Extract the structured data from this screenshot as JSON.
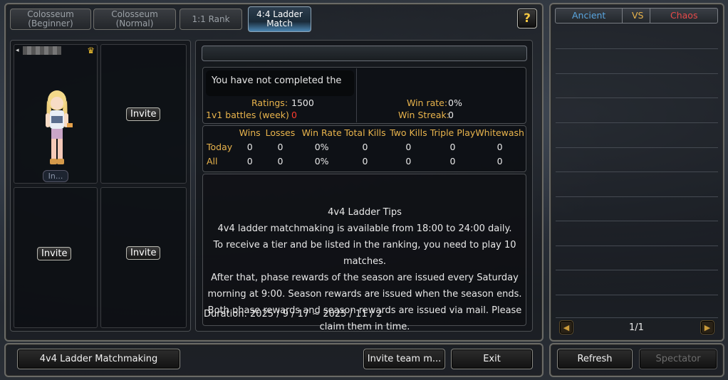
{
  "tabs": [
    {
      "label": "Colosseum (Beginner)"
    },
    {
      "label": "Colosseum (Normal)"
    },
    {
      "label": "1:1 Rank"
    },
    {
      "label": "4:4 Ladder Match"
    }
  ],
  "help_label": "?",
  "party": {
    "leader_name": "",
    "leader_status": "In...",
    "invite_label": "Invite"
  },
  "search_bar_value": "",
  "profile": {
    "notice": "You have not completed the",
    "ratings_label": "Ratings:",
    "ratings_value": "1500",
    "battles_label": "1v1 battles (week)",
    "battles_value": "0",
    "winrate_label": "Win rate:",
    "winrate_value": "0%",
    "winstreak_label": "Win Streak:",
    "winstreak_value": "0"
  },
  "stats": {
    "headers": [
      "",
      "Wins",
      "Losses",
      "Win Rate",
      "Total Kills",
      "Two Kills",
      "Triple Play",
      "Whitewash"
    ],
    "rows": [
      {
        "label": "Today",
        "values": [
          "0",
          "0",
          "0%",
          "0",
          "0",
          "0",
          "0"
        ]
      },
      {
        "label": "All",
        "values": [
          "0",
          "0",
          "0%",
          "0",
          "0",
          "0",
          "0"
        ]
      }
    ]
  },
  "tips": {
    "title": "4v4 Ladder Tips",
    "lines": [
      "4v4 ladder matchmaking is available from 18:00 to 24:00 daily.",
      "To receive a tier and be listed in the ranking, you need to play 10",
      "matches.",
      "After that, phase rewards of the season are issued every Saturday",
      "morning at 9:00. Season rewards are issued when the season ends.",
      "Both phase rewards and season rewards are issued via mail. Please",
      "claim them in time."
    ],
    "duration": "Duration: 2025 / 9 / 17 ~ 2025 / 11 / 2"
  },
  "footer": {
    "matchmaking_label": "4v4 Ladder Matchmaking",
    "invite_team_label": "Invite team m...",
    "exit_label": "Exit"
  },
  "side": {
    "ancient_label": "Ancient",
    "vs_label": "VS",
    "chaos_label": "Chaos",
    "page": "1/1",
    "refresh_label": "Refresh",
    "spectator_label": "Spectator"
  },
  "colors": {
    "gold": "#e9b44c",
    "red": "#ff3b2f",
    "ancient": "#5aa6e0",
    "chaos": "#e84a4a"
  }
}
